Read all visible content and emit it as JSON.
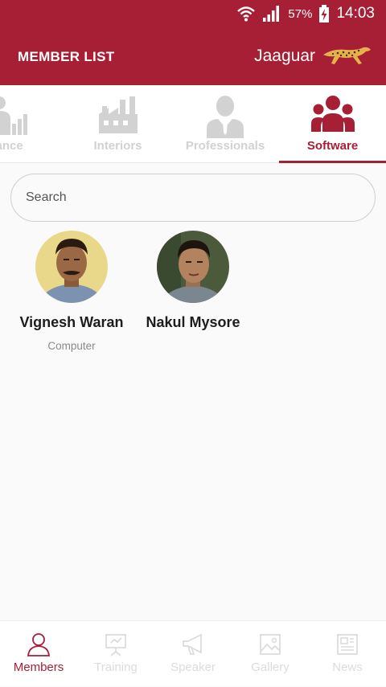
{
  "status_bar": {
    "battery": "57%",
    "time": "14:03"
  },
  "header": {
    "title": "MEMBER LIST",
    "brand": "Jaaguar"
  },
  "tabs": [
    {
      "label": "nance",
      "icon": "bar-chart-icon"
    },
    {
      "label": "Interiors",
      "icon": "factory-icon"
    },
    {
      "label": "Professionals",
      "icon": "businessman-icon"
    },
    {
      "label": "Software",
      "icon": "group-icon",
      "active": true
    }
  ],
  "search": {
    "placeholder": "Search",
    "value": ""
  },
  "members": [
    {
      "name": "Vignesh Waran",
      "category": "Computer"
    },
    {
      "name": "Nakul Mysore",
      "category": ""
    }
  ],
  "bottom_nav": [
    {
      "label": "Members",
      "icon": "members-icon",
      "active": true
    },
    {
      "label": "Training",
      "icon": "training-icon"
    },
    {
      "label": "Speaker",
      "icon": "megaphone-icon"
    },
    {
      "label": "Gallery",
      "icon": "gallery-icon"
    },
    {
      "label": "News",
      "icon": "newspaper-icon"
    }
  ],
  "colors": {
    "primary": "#a61f35",
    "inactive": "#d2d2d2"
  }
}
